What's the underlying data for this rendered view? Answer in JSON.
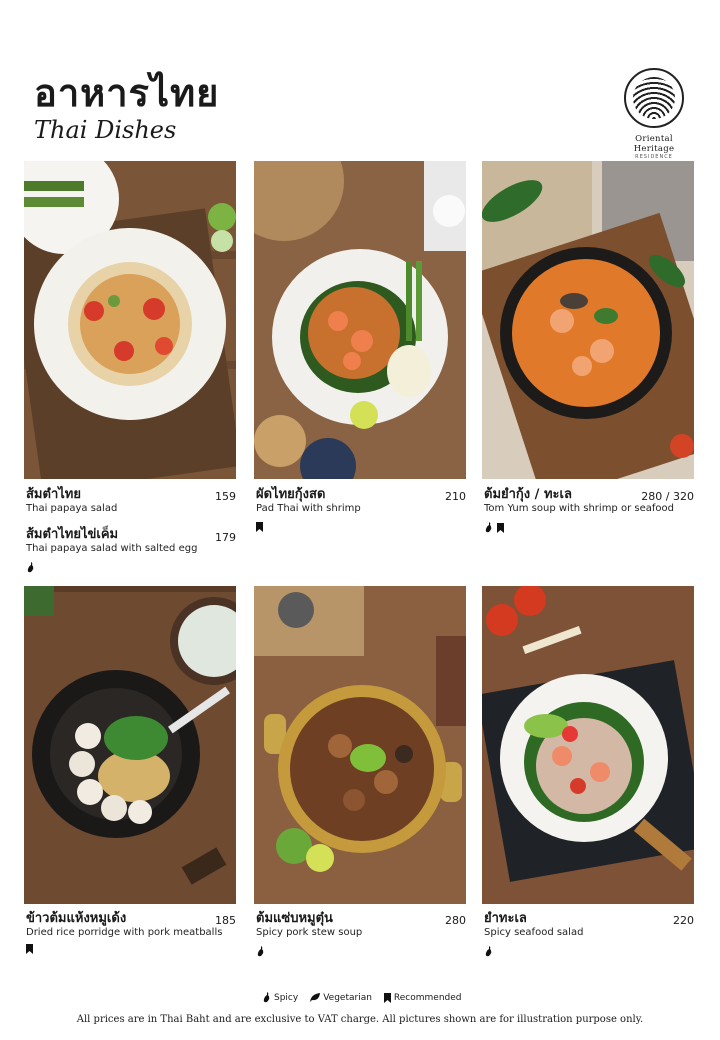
{
  "header": {
    "title_thai": "อาหารไทย",
    "title_english": "Thai Dishes",
    "logo": {
      "name": "Oriental Heritage",
      "sub": "RESIDENCE"
    }
  },
  "dishes": [
    {
      "name_thai": "ส้มตำไทย",
      "name_en": "Thai papaya salad",
      "price": "159"
    },
    {
      "name_thai": "ส้มตำไทยไข่เค็ม",
      "name_en": "Thai papaya salad with salted egg",
      "price": "179"
    },
    {
      "name_thai": "ผัดไทยกุ้งสด",
      "name_en": "Pad Thai with shrimp",
      "price": "210"
    },
    {
      "name_thai": "ต้มยำกุ้ง / ทะเล",
      "name_en": "Tom Yum soup with shrimp or seafood",
      "price": "280 / 320"
    },
    {
      "name_thai": "ข้าวต้มแห้งหมูเด้ง",
      "name_en": "Dried rice porridge with pork meatballs",
      "price": "185"
    },
    {
      "name_thai": "ต้มแซ่บหมูตุ๋น",
      "name_en": "Spicy pork stew soup",
      "price": "280"
    },
    {
      "name_thai": "ยำทะเล",
      "name_en": "Spicy seafood salad",
      "price": "220"
    }
  ],
  "legend": {
    "spicy": "Spicy",
    "vegetarian": "Vegetarian",
    "recommended": "Recommended"
  },
  "footer": "All prices are in Thai Baht and are exclusive to VAT charge. All pictures shown are for illustration purpose only.",
  "icon_names": {
    "spicy": "chili-icon",
    "vegetarian": "leaf-icon",
    "recommended": "bookmark-icon"
  },
  "colors": {
    "wood": "#7a5236",
    "plate": "#f4f2ee",
    "text": "#1a1a1a"
  }
}
